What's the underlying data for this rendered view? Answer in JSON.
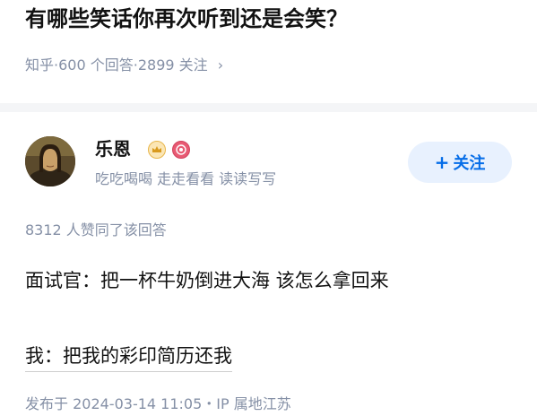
{
  "question": {
    "title": "有哪些笑话你再次听到还是会笑？",
    "site": "知乎",
    "sep1": " · ",
    "answers": "600 个回答",
    "sep2": " · ",
    "followers": "2899 关注",
    "chevron": "›"
  },
  "author": {
    "name": "乐恩",
    "bio": "吃吃喝喝 走走看看 读读写写",
    "badges": [
      "crown-badge-icon",
      "pink-badge-icon"
    ]
  },
  "follow_button": {
    "plus": "+",
    "label": "关注"
  },
  "answer": {
    "likes": "8312 人赞同了该回答",
    "line1": "面试官：把一杯牛奶倒进大海 该怎么拿回来",
    "line2": "我：把我的彩印简历还我",
    "published": "发布于 2024-03-14 11:05・IP 属地江苏"
  },
  "colors": {
    "accent": "#056de8",
    "muted": "#8590a6",
    "button_bg": "#e8f1fe"
  }
}
